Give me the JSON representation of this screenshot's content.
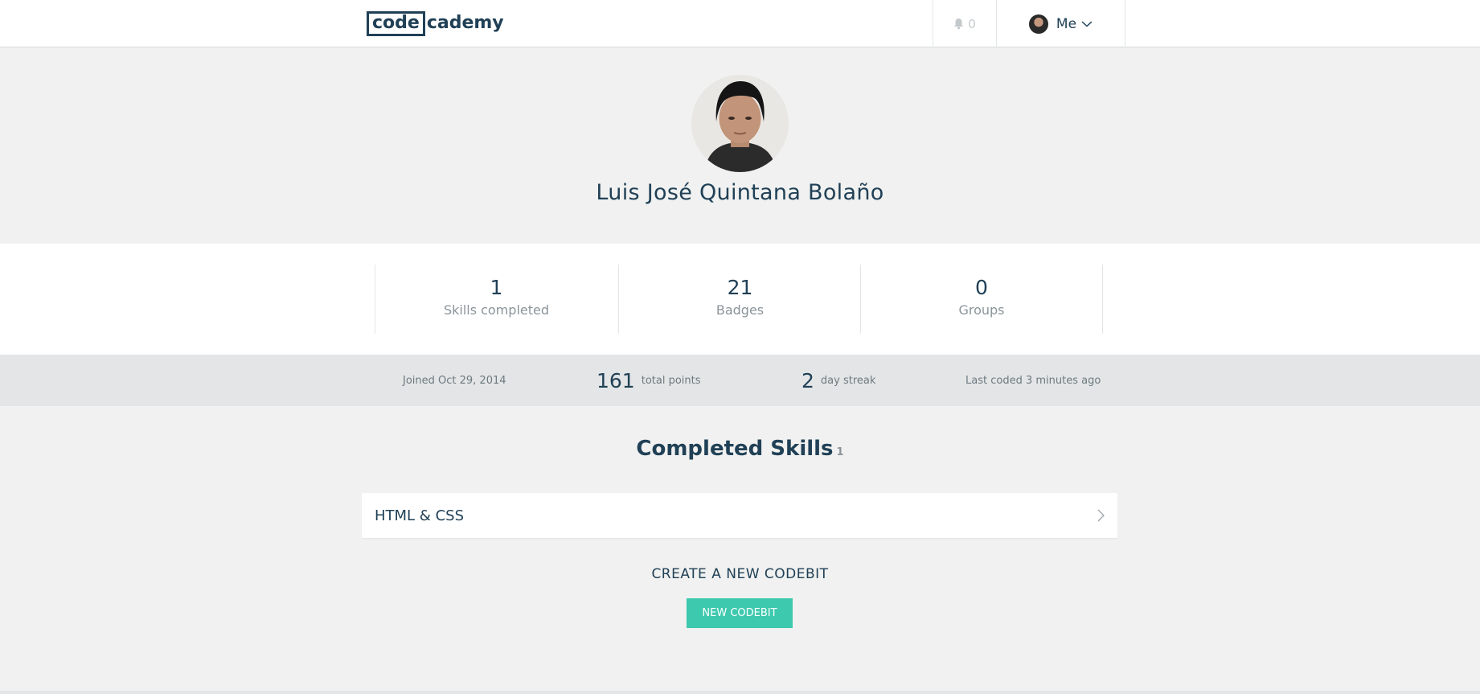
{
  "header": {
    "logo_code": "code",
    "logo_cademy": "cademy",
    "notification_count": "0",
    "me_label": "Me"
  },
  "profile": {
    "name": "Luis José Quintana Bolaño"
  },
  "stats": [
    {
      "value": "1",
      "label": "Skills completed"
    },
    {
      "value": "21",
      "label": "Badges"
    },
    {
      "value": "0",
      "label": "Groups"
    }
  ],
  "meta": {
    "joined": "Joined Oct 29, 2014",
    "points_value": "161",
    "points_label": "total points",
    "streak_value": "2",
    "streak_label": "day streak",
    "last_coded": "Last coded 3 minutes ago"
  },
  "completed_skills": {
    "title": "Completed Skills",
    "count": "1",
    "items": [
      {
        "name": "HTML & CSS"
      }
    ]
  },
  "codebit": {
    "title": "CREATE A NEW CODEBIT",
    "button_label": "NEW CODEBIT"
  },
  "colors": {
    "brand": "#204056",
    "accent": "#3dc9ae",
    "background": "#f0f1f0"
  }
}
